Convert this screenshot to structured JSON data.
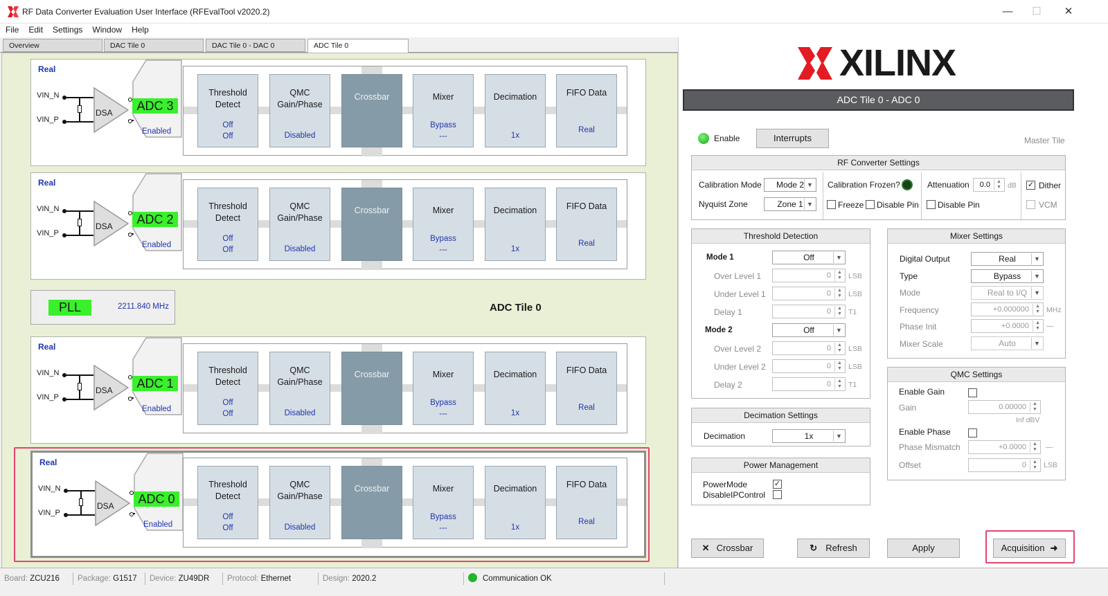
{
  "window": {
    "title": "RF Data Converter Evaluation User Interface (RFEvalTool v2020.2)",
    "minimize": "—",
    "maximize": "☐",
    "close": "✕"
  },
  "menu": [
    "File",
    "Edit",
    "Settings",
    "Window",
    "Help"
  ],
  "tabs": [
    "Overview",
    "DAC Tile 0",
    "DAC Tile 0 - DAC 0",
    "ADC Tile 0"
  ],
  "left": {
    "pll": {
      "label": "PLL",
      "freq": "2211.840 MHz"
    },
    "tile_label": "ADC Tile 0",
    "adcs": [
      {
        "name": "ADC 3",
        "mode": "Real",
        "vin_n": "VIN_N",
        "vin_p": "VIN_P",
        "dsa": "DSA",
        "status": "Enabled"
      },
      {
        "name": "ADC 2",
        "mode": "Real",
        "vin_n": "VIN_N",
        "vin_p": "VIN_P",
        "dsa": "DSA",
        "status": "Enabled"
      },
      {
        "name": "ADC 1",
        "mode": "Real",
        "vin_n": "VIN_N",
        "vin_p": "VIN_P",
        "dsa": "DSA",
        "status": "Enabled"
      },
      {
        "name": "ADC 0",
        "mode": "Real",
        "vin_n": "VIN_N",
        "vin_p": "VIN_P",
        "dsa": "DSA",
        "status": "Enabled"
      }
    ],
    "blocks": {
      "threshold": {
        "n1": "Threshold",
        "n2": "Detect",
        "v1": "Off",
        "v2": "Off"
      },
      "qmc": {
        "n1": "QMC",
        "n2": "Gain/Phase",
        "v1": "Disabled"
      },
      "crossbar": {
        "n1": "Crossbar"
      },
      "mixer": {
        "n1": "Mixer",
        "v1": "Bypass",
        "v2": "---"
      },
      "decimation": {
        "n1": "Decimation",
        "v1": "1x"
      },
      "fifo": {
        "n1": "FIFO Data",
        "v1": "Real"
      }
    }
  },
  "right": {
    "logo": "XILINX",
    "heading": "ADC Tile 0 - ADC 0",
    "enable": "Enable",
    "interrupts": "Interrupts",
    "master": "Master Tile",
    "rf": {
      "title": "RF Converter Settings",
      "cal_mode": "Calibration Mode",
      "cal_mode_val": "Mode 2",
      "nyquist": "Nyquist Zone",
      "nyquist_val": "Zone 1",
      "cal_frozen": "Calibration Frozen?",
      "freeze": "Freeze",
      "disable_pin": "Disable Pin",
      "atten": "Attenuation",
      "atten_val": "0.0",
      "atten_unit": "dB",
      "disable_pin2": "Disable Pin",
      "dither": "Dither",
      "vcm": "VCM"
    },
    "threshold": {
      "title": "Threshold Detection",
      "mode1": "Mode 1",
      "mode1_val": "Off",
      "over1": "Over Level 1",
      "under1": "Under Level 1",
      "delay1": "Delay 1",
      "mode2": "Mode 2",
      "mode2_val": "Off",
      "over2": "Over Level 2",
      "under2": "Under Level 2",
      "delay2": "Delay 2",
      "zero": "0",
      "lsb": "LSB",
      "t1": "T1"
    },
    "mixer": {
      "title": "Mixer Settings",
      "digital_output": "Digital Output",
      "digital_output_val": "Real",
      "type": "Type",
      "type_val": "Bypass",
      "mode": "Mode",
      "mode_val": "Real to I/Q",
      "frequency": "Frequency",
      "frequency_val": "+0.000000",
      "frequency_unit": "MHz",
      "phase_init": "Phase Init",
      "phase_init_val": "+0.0000",
      "phase_unit": "—",
      "scale": "Mixer Scale",
      "scale_val": "Auto"
    },
    "qmc": {
      "title": "QMC Settings",
      "enable_gain": "Enable Gain",
      "gain": "Gain",
      "gain_val": "0.00000",
      "gain_unit": "Inf dBV",
      "enable_phase": "Enable Phase",
      "phase_mismatch": "Phase Mismatch",
      "phase_val": "+0.0000",
      "phase_unit": "—",
      "offset": "Offset",
      "offset_val": "0",
      "offset_unit": "LSB"
    },
    "decimation": {
      "title": "Decimation Settings",
      "label": "Decimation",
      "val": "1x"
    },
    "power": {
      "title": "Power Management",
      "powermode": "PowerMode",
      "disableip": "DisableIPControl"
    },
    "buttons": {
      "crossbar": "Crossbar",
      "refresh": "Refresh",
      "apply": "Apply",
      "acquisition": "Acquisition"
    }
  },
  "status": {
    "board_k": "Board:",
    "board": "ZCU216",
    "package_k": "Package:",
    "package": "G1517",
    "device_k": "Device:",
    "device": "ZU49DR",
    "protocol_k": "Protocol:",
    "protocol": "Ethernet",
    "design_k": "Design:",
    "design": "2020.2",
    "comm": "Communication OK"
  },
  "colors": {
    "adc_green": "#39f02b",
    "accent_blue": "#1f35b0",
    "highlight": "#e0456f",
    "pane_bg": "#e9f0d5",
    "xilinx_red": "#e31b23"
  }
}
